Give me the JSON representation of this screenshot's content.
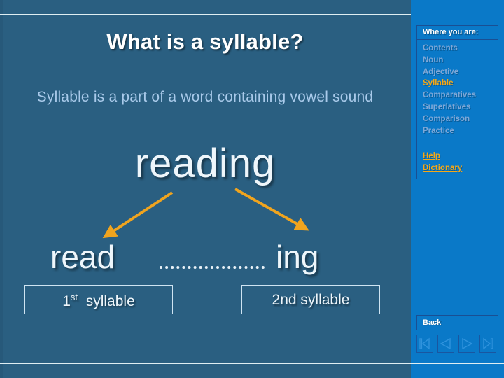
{
  "slide": {
    "title": "What is a syllable?",
    "subtitle": "Syllable is a part of a word containing vowel sound",
    "word": "reading",
    "parts": {
      "first": "read",
      "second": "ing"
    },
    "labels": {
      "first_ordinal": "1",
      "first_suffix": "st",
      "first_text": "syllable",
      "second": "2nd syllable"
    },
    "colors": {
      "background": "#2a5f81",
      "title_text": "#ffffff",
      "subtitle_text": "#a9caea",
      "word_text": "#eef6fb",
      "arrow": "#f0a41e",
      "rule": "#dfeef2"
    }
  },
  "sidebar": {
    "header": "Where you are:",
    "items": [
      {
        "label": "Contents",
        "active": false
      },
      {
        "label": "Noun",
        "active": false
      },
      {
        "label": "Adjective",
        "active": false
      },
      {
        "label": "Syllable",
        "active": true
      },
      {
        "label": "Comparatives",
        "active": false
      },
      {
        "label": "Superlatives",
        "active": false
      },
      {
        "label": "Comparison",
        "active": false
      },
      {
        "label": "Practice",
        "active": false
      }
    ],
    "links": [
      {
        "label": "Help"
      },
      {
        "label": "Dictionary"
      }
    ],
    "back_label": "Back",
    "nav_buttons": [
      {
        "name": "first-slide-button",
        "icon": "first-icon"
      },
      {
        "name": "previous-slide-button",
        "icon": "previous-icon"
      },
      {
        "name": "next-slide-button",
        "icon": "next-icon"
      },
      {
        "name": "last-slide-button",
        "icon": "last-icon"
      }
    ],
    "colors": {
      "background": "#0a79c8",
      "item_text": "#7ea8d8",
      "active_text": "#f5a818",
      "link_text": "#f5a818",
      "border": "#1a4f93"
    }
  }
}
